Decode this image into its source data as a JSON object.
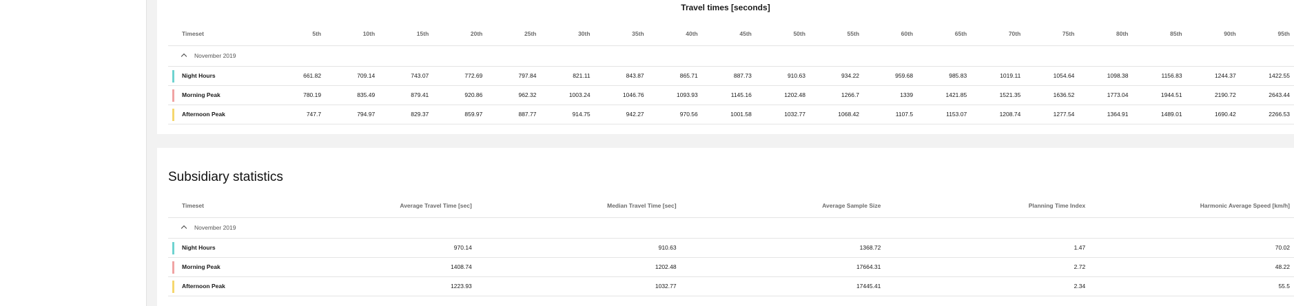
{
  "travel_times": {
    "title": "Travel times [seconds]",
    "columns": [
      "Timeset",
      "5th",
      "10th",
      "15th",
      "20th",
      "25th",
      "30th",
      "35th",
      "40th",
      "45th",
      "50th",
      "55th",
      "60th",
      "65th",
      "70th",
      "75th",
      "80th",
      "85th",
      "90th",
      "95th"
    ],
    "group_label": "November 2019",
    "rows": [
      {
        "label": "Night Hours",
        "color": "#6fd3d0",
        "values": [
          "661.82",
          "709.14",
          "743.07",
          "772.69",
          "797.84",
          "821.11",
          "843.87",
          "865.71",
          "887.73",
          "910.63",
          "934.22",
          "959.68",
          "985.83",
          "1019.11",
          "1054.64",
          "1098.38",
          "1156.83",
          "1244.37",
          "1422.55"
        ]
      },
      {
        "label": "Morning Peak",
        "color": "#f0a3a3",
        "values": [
          "780.19",
          "835.49",
          "879.41",
          "920.86",
          "962.32",
          "1003.24",
          "1046.76",
          "1093.93",
          "1145.16",
          "1202.48",
          "1266.7",
          "1339",
          "1421.85",
          "1521.35",
          "1636.52",
          "1773.04",
          "1944.51",
          "2190.72",
          "2643.44"
        ]
      },
      {
        "label": "Afternoon Peak",
        "color": "#f5d76e",
        "values": [
          "747.7",
          "794.97",
          "829.37",
          "859.97",
          "887.77",
          "914.75",
          "942.27",
          "970.56",
          "1001.58",
          "1032.77",
          "1068.42",
          "1107.5",
          "1153.07",
          "1208.74",
          "1277.54",
          "1364.91",
          "1489.01",
          "1690.42",
          "2266.53"
        ]
      }
    ]
  },
  "subsidiary": {
    "title": "Subsidiary statistics",
    "columns": [
      "Timeset",
      "Average Travel Time [sec]",
      "Median Travel Time [sec]",
      "Average Sample Size",
      "Planning Time Index",
      "Harmonic Average Speed [km/h]"
    ],
    "group_label": "November 2019",
    "rows": [
      {
        "label": "Night Hours",
        "color": "#6fd3d0",
        "values": [
          "970.14",
          "910.63",
          "1368.72",
          "1.47",
          "70.02"
        ]
      },
      {
        "label": "Morning Peak",
        "color": "#f0a3a3",
        "values": [
          "1408.74",
          "1202.48",
          "17664.31",
          "2.72",
          "48.22"
        ]
      },
      {
        "label": "Afternoon Peak",
        "color": "#f5d76e",
        "values": [
          "1223.93",
          "1032.77",
          "17445.41",
          "2.34",
          "55.5"
        ]
      }
    ]
  }
}
